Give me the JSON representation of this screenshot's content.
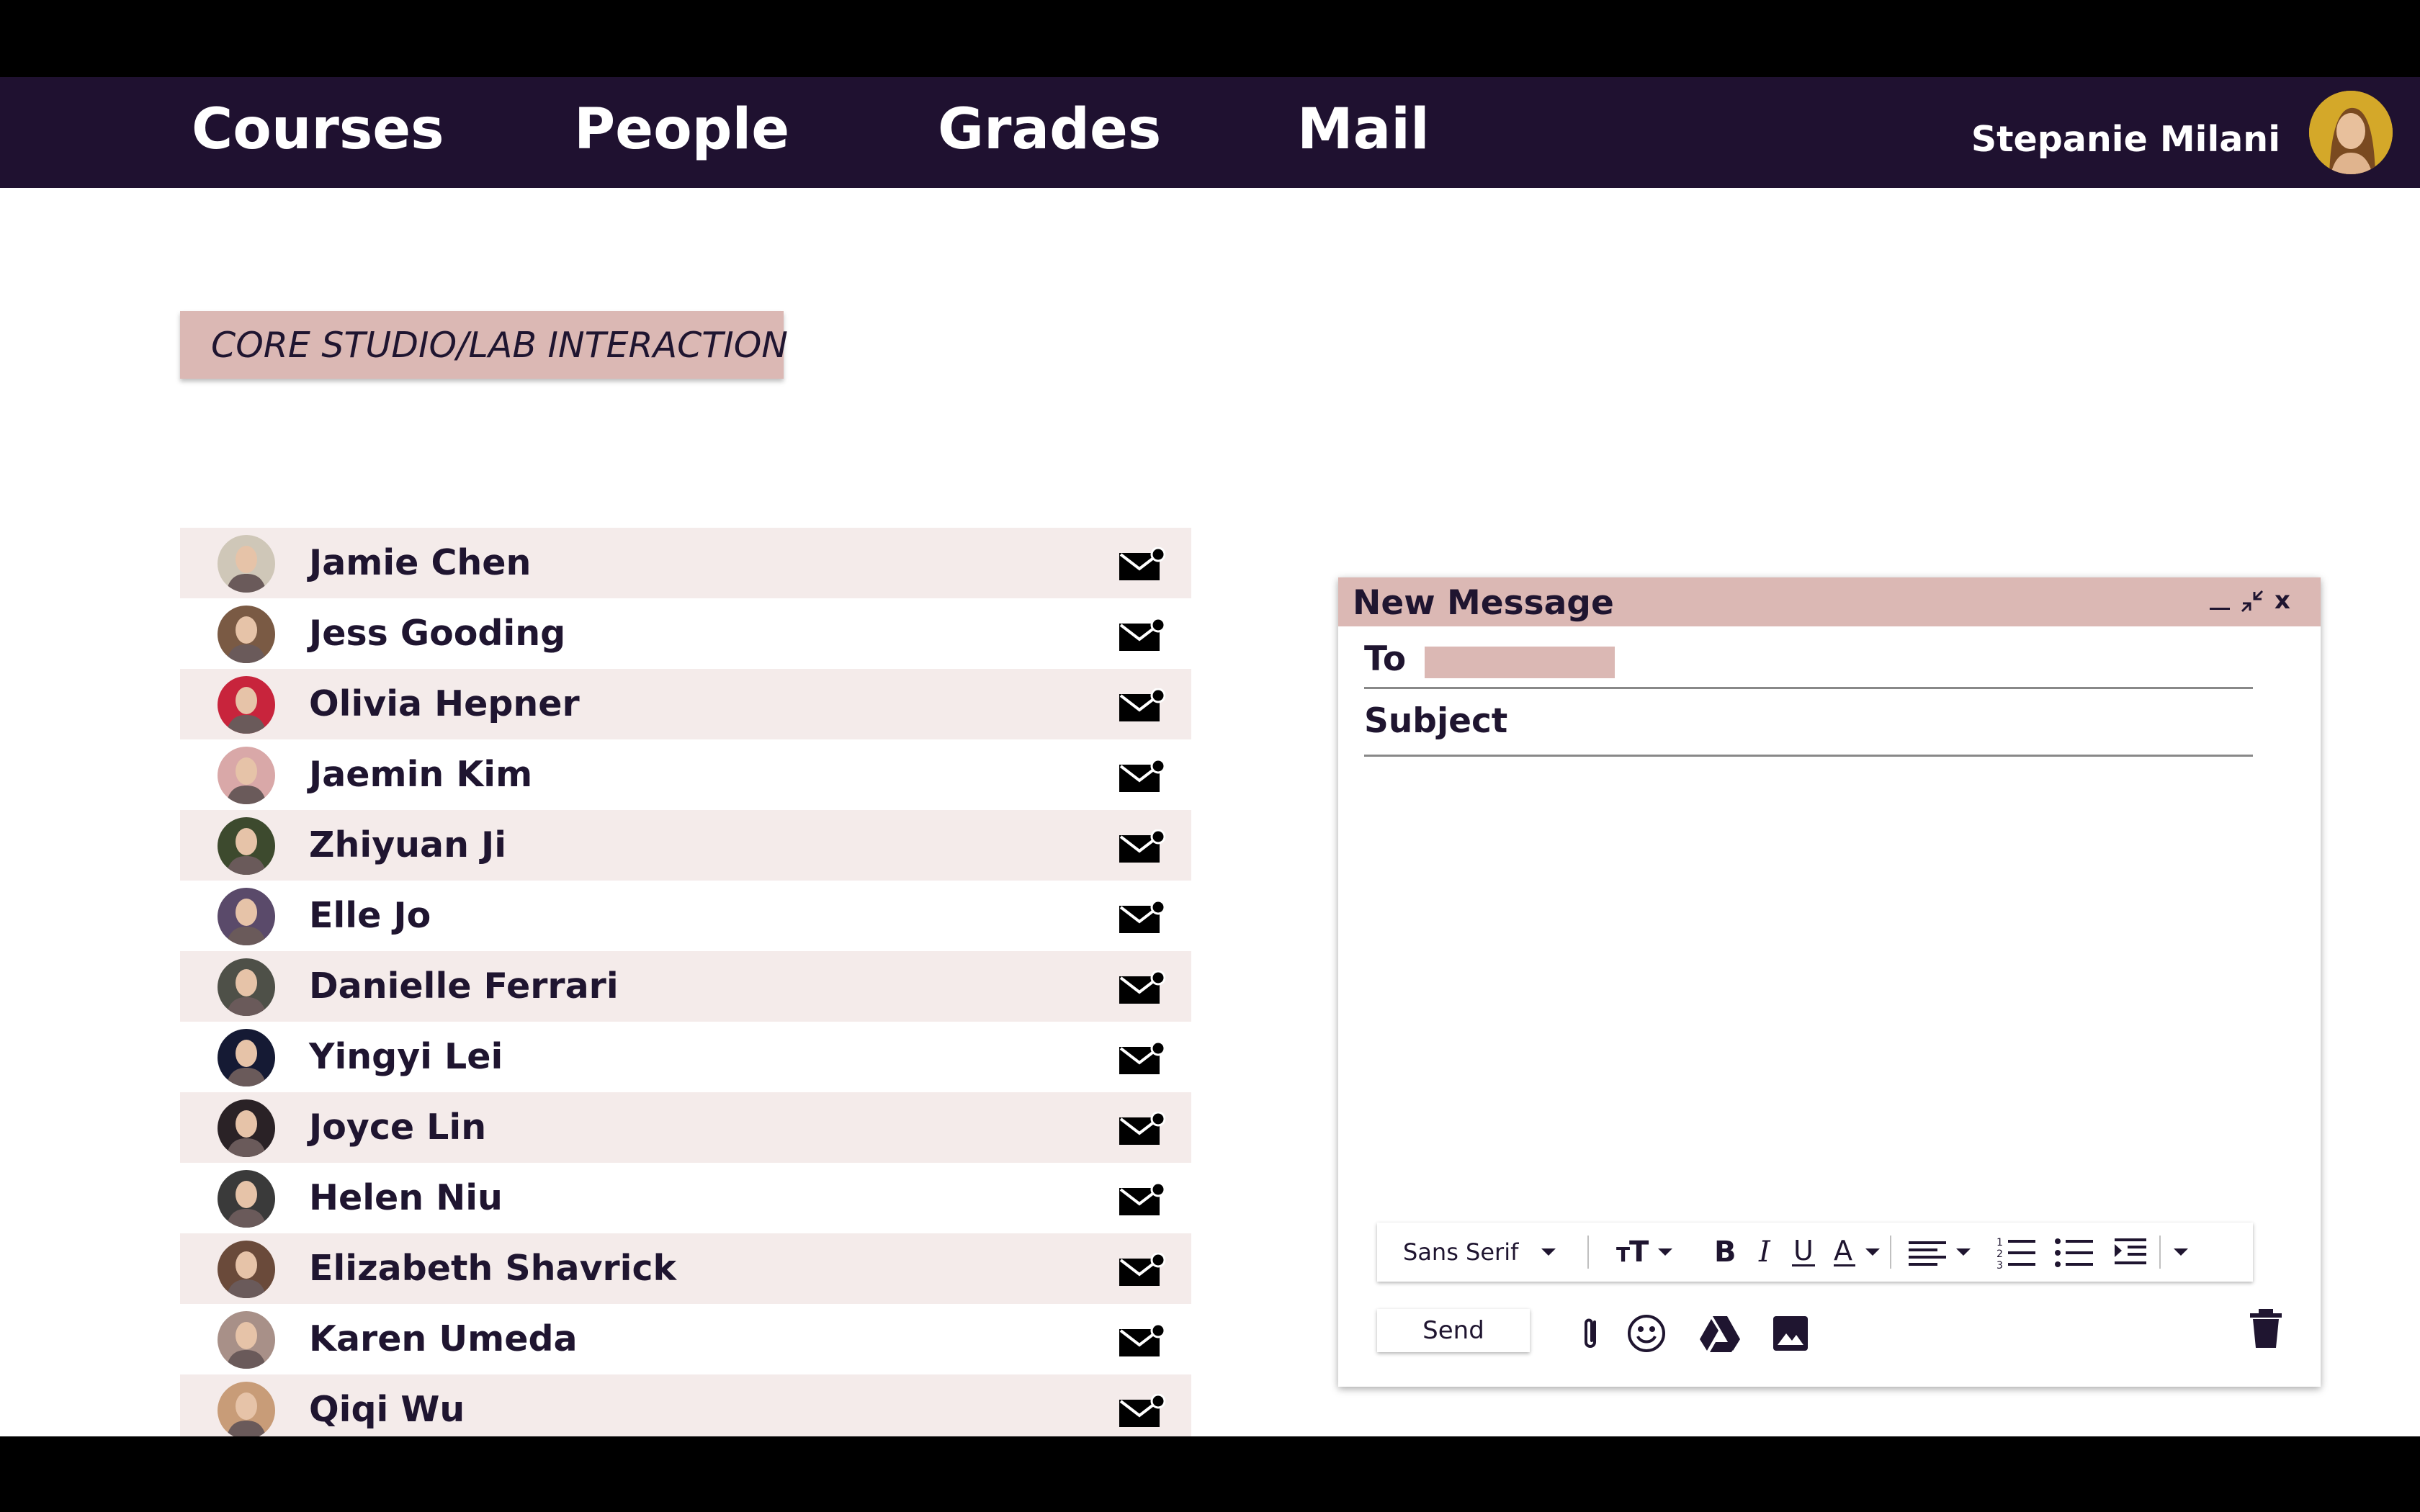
{
  "nav": {
    "items": [
      {
        "label": "Courses"
      },
      {
        "label": "People"
      },
      {
        "label": "Grades"
      },
      {
        "label": "Mail"
      }
    ],
    "user_name": "Stepanie Milani"
  },
  "course": {
    "title": "CORE STUDIO/LAB INTERACTION"
  },
  "people": [
    {
      "name": "Jamie Chen",
      "avatar_color": "#cfc7b8"
    },
    {
      "name": "Jess Gooding",
      "avatar_color": "#7a5a44"
    },
    {
      "name": "Olivia Hepner",
      "avatar_color": "#c8243c"
    },
    {
      "name": "Jaemin Kim",
      "avatar_color": "#d9a8a8"
    },
    {
      "name": "Zhiyuan Ji",
      "avatar_color": "#3d4a2e"
    },
    {
      "name": "Elle Jo",
      "avatar_color": "#5a4a6a"
    },
    {
      "name": "Danielle Ferrari",
      "avatar_color": "#4e5048"
    },
    {
      "name": "Yingyi Lei",
      "avatar_color": "#151a34"
    },
    {
      "name": "Joyce Lin",
      "avatar_color": "#2a2226"
    },
    {
      "name": "Helen Niu",
      "avatar_color": "#3a3a3a"
    },
    {
      "name": "Elizabeth Shavrick",
      "avatar_color": "#6a4a3a"
    },
    {
      "name": "Karen Umeda",
      "avatar_color": "#a89088"
    },
    {
      "name": "Qiqi Wu",
      "avatar_color": "#c89c78"
    }
  ],
  "compose": {
    "title": "New Message",
    "minimize_label": "_",
    "close_label": "x",
    "to_label": "To",
    "subject_label": "Subject",
    "font_label": "Sans Serif",
    "send_label": "Send"
  },
  "colors": {
    "nav_bg": "#1f1130",
    "accent_pink": "#dbb8b4",
    "row_alt": "#f4ebea",
    "text_dark": "#1f1530"
  }
}
